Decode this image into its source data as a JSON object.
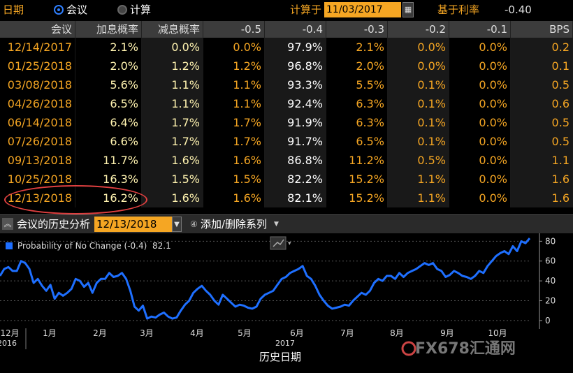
{
  "toolbar": {
    "date_label": "日期",
    "mode_meeting": "会议",
    "mode_calc": "计算",
    "calc_date_label": "计算于",
    "calc_date": "11/03/2017",
    "base_rate_label": "基于利率",
    "base_rate_value": "-0.40"
  },
  "table": {
    "headers": [
      "会议",
      "加息概率",
      "减息概率",
      "-0.5",
      "-0.4",
      "-0.3",
      "-0.2",
      "-0.1",
      "BPS"
    ],
    "rows": [
      [
        "12/14/2017",
        "2.1%",
        "0.0%",
        "0.0%",
        "97.9%",
        "2.1%",
        "0.0%",
        "0.0%",
        "0.2"
      ],
      [
        "01/25/2018",
        "2.0%",
        "1.2%",
        "1.2%",
        "96.8%",
        "2.0%",
        "0.0%",
        "0.0%",
        "0.1"
      ],
      [
        "03/08/2018",
        "5.6%",
        "1.1%",
        "1.1%",
        "93.3%",
        "5.5%",
        "0.1%",
        "0.0%",
        "0.5"
      ],
      [
        "04/26/2018",
        "6.5%",
        "1.1%",
        "1.1%",
        "92.4%",
        "6.3%",
        "0.1%",
        "0.0%",
        "0.6"
      ],
      [
        "06/14/2018",
        "6.4%",
        "1.7%",
        "1.7%",
        "91.9%",
        "6.3%",
        "0.1%",
        "0.0%",
        "0.5"
      ],
      [
        "07/26/2018",
        "6.6%",
        "1.7%",
        "1.7%",
        "91.7%",
        "6.5%",
        "0.1%",
        "0.0%",
        "0.5"
      ],
      [
        "09/13/2018",
        "11.7%",
        "1.6%",
        "1.6%",
        "86.8%",
        "11.2%",
        "0.5%",
        "0.0%",
        "1.1"
      ],
      [
        "10/25/2018",
        "16.3%",
        "1.5%",
        "1.5%",
        "82.2%",
        "15.2%",
        "1.1%",
        "0.0%",
        "1.6"
      ],
      [
        "12/13/2018",
        "16.2%",
        "1.6%",
        "1.6%",
        "82.1%",
        "15.2%",
        "1.1%",
        "0.0%",
        "1.6"
      ]
    ]
  },
  "history": {
    "title": "会议的历史分析",
    "date": "12/13/2018",
    "add_remove_label": "添加/删除系列"
  },
  "colors": {
    "accent": "#f5a623",
    "series": "#1e6fff",
    "highlight_circle": "#e04040"
  },
  "chart_data": {
    "type": "line",
    "legend_label": "Probability of No Change (-0.4)",
    "last_value": "82.1",
    "xlabel": "历史日期",
    "ylim": [
      -5,
      88
    ],
    "y_ticks": [
      0,
      20,
      40,
      60,
      80
    ],
    "x_ticks": [
      "12月",
      "1月",
      "2月",
      "3月",
      "4月",
      "5月",
      "6月",
      "7月",
      "8月",
      "9月",
      "10月"
    ],
    "year_labels": [
      "2016",
      "2017"
    ],
    "series": [
      {
        "values": [
          45,
          52,
          54,
          50,
          50,
          60,
          58,
          52,
          38,
          42,
          35,
          30,
          36,
          22,
          28,
          25,
          28,
          32,
          42,
          40,
          34,
          38,
          28,
          38,
          42,
          42,
          48,
          44,
          45,
          48,
          42,
          30,
          14,
          10,
          15,
          2,
          4,
          3,
          6,
          8,
          4,
          2,
          3,
          10,
          16,
          20,
          28,
          32,
          35,
          30,
          26,
          20,
          16,
          26,
          22,
          18,
          14,
          16,
          15,
          13,
          12,
          14,
          22,
          26,
          28,
          30,
          36,
          42,
          44,
          48,
          50,
          52,
          55,
          45,
          42,
          35,
          26,
          20,
          15,
          12,
          13,
          14,
          16,
          15,
          20,
          24,
          28,
          26,
          30,
          38,
          42,
          40,
          45,
          45,
          42,
          48,
          44,
          48,
          50,
          52,
          55,
          58,
          56,
          58,
          52,
          50,
          44,
          46,
          50,
          48,
          45,
          44,
          42,
          45,
          50,
          48,
          55,
          60,
          65,
          68,
          70,
          67,
          75,
          70,
          80,
          78,
          83
        ]
      }
    ]
  },
  "watermark": "FX678汇通网"
}
